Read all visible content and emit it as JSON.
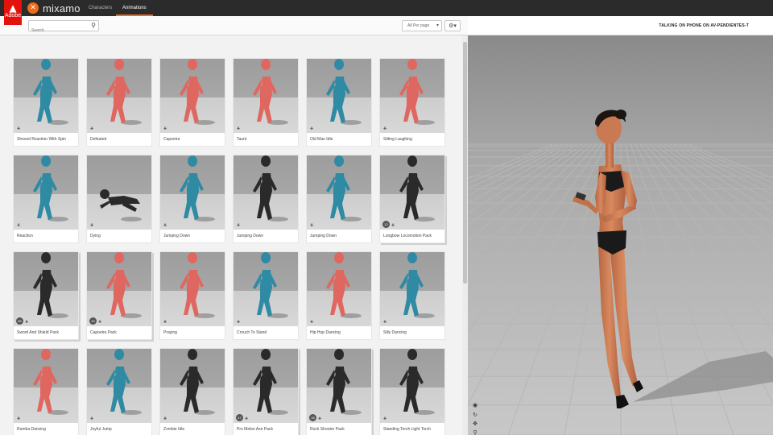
{
  "app": {
    "brand": "mixamo",
    "adobe_label": "Adobe",
    "nav": [
      "Characters",
      "Animations"
    ],
    "active_tab": "Animations"
  },
  "toolbar": {
    "search_placeholder": "Search",
    "per_page": "All Per page"
  },
  "viewer": {
    "title": "TALKING ON PHONE ON AV-PENDIENTES-T"
  },
  "colors": {
    "accent": "#f26a1b",
    "adobe_red": "#e3130b",
    "teal_model": "#2f8aa3",
    "coral_model": "#e0675f"
  },
  "cards": [
    {
      "label": "Shoved Reaction With Spin",
      "color": "teal"
    },
    {
      "label": "Defeated",
      "color": "coral"
    },
    {
      "label": "Capoeira",
      "color": "coral"
    },
    {
      "label": "Taunt",
      "color": "coral"
    },
    {
      "label": "Old Man Idle",
      "color": "teal"
    },
    {
      "label": "Sitting Laughing",
      "color": "coral"
    },
    {
      "label": "Reaction",
      "color": "teal"
    },
    {
      "label": "Dying",
      "color": "dark"
    },
    {
      "label": "Jumping Down",
      "color": "teal"
    },
    {
      "label": "Jumping Down",
      "color": "dark"
    },
    {
      "label": "Jumping Down",
      "color": "teal"
    },
    {
      "label": "Longbow Locomotion Pack",
      "color": "dark",
      "pack": true,
      "count": "12"
    },
    {
      "label": "Sword And Shield Pack",
      "color": "dark",
      "pack": true,
      "count": "89"
    },
    {
      "label": "Capoeira Pack",
      "color": "coral",
      "pack": true,
      "count": "19"
    },
    {
      "label": "Praying",
      "color": "coral"
    },
    {
      "label": "Crouch To Stand",
      "color": "teal"
    },
    {
      "label": "Hip Hop Dancing",
      "color": "coral"
    },
    {
      "label": "Silly Dancing",
      "color": "teal"
    },
    {
      "label": "Rumba Dancing",
      "color": "coral"
    },
    {
      "label": "Joyful Jump",
      "color": "teal"
    },
    {
      "label": "Zombie Idle",
      "color": "dark"
    },
    {
      "label": "Pro Melee Axe Pack",
      "color": "dark",
      "pack": true,
      "count": "47"
    },
    {
      "label": "Rock Shooter Pack",
      "color": "dark",
      "pack": true,
      "count": "16"
    },
    {
      "label": "Standing Torch Light Torch",
      "color": "dark"
    }
  ]
}
